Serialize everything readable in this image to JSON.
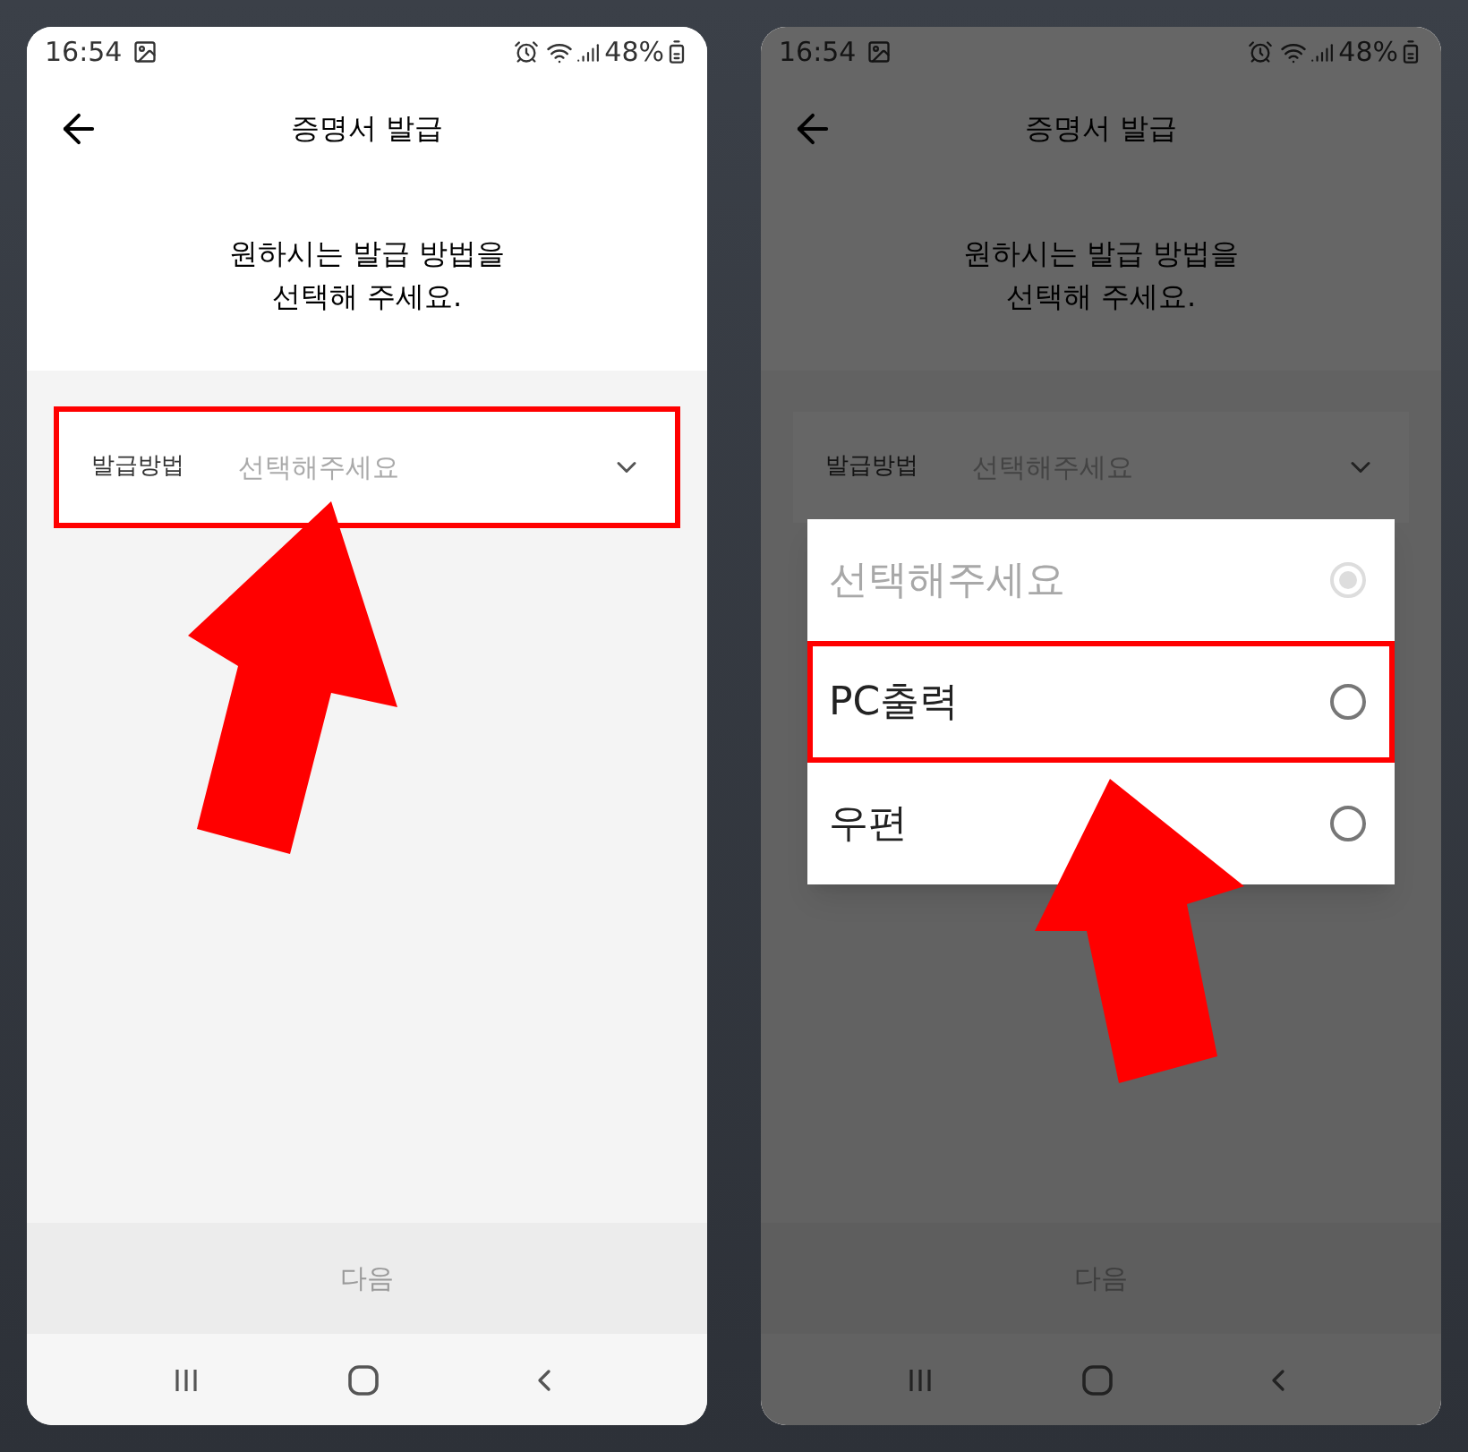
{
  "screens": [
    {
      "status_bar": {
        "time": "16:54",
        "battery": "48%"
      },
      "title": "증명서 발급",
      "message": "원하시는 발급 방법을\n선택해 주세요.",
      "field": {
        "label": "발급방법",
        "placeholder": "선택해주세요",
        "highlighted": true
      },
      "next_button": "다음",
      "dimmed": false,
      "pointer_arrow": true
    },
    {
      "status_bar": {
        "time": "16:54",
        "battery": "48%"
      },
      "title": "증명서 발급",
      "message": "원하시는 발급 방법을\n선택해 주세요.",
      "field": {
        "label": "발급방법",
        "placeholder": "선택해주세요",
        "highlighted": false
      },
      "next_button": "다음",
      "dimmed": true,
      "pointer_arrow": true,
      "dialog": {
        "options": [
          {
            "label": "선택해주세요",
            "selected": true,
            "disabled": true,
            "highlighted": false
          },
          {
            "label": "PC출력",
            "selected": false,
            "disabled": false,
            "highlighted": true
          },
          {
            "label": "우편",
            "selected": false,
            "disabled": false,
            "highlighted": false
          }
        ]
      }
    }
  ]
}
